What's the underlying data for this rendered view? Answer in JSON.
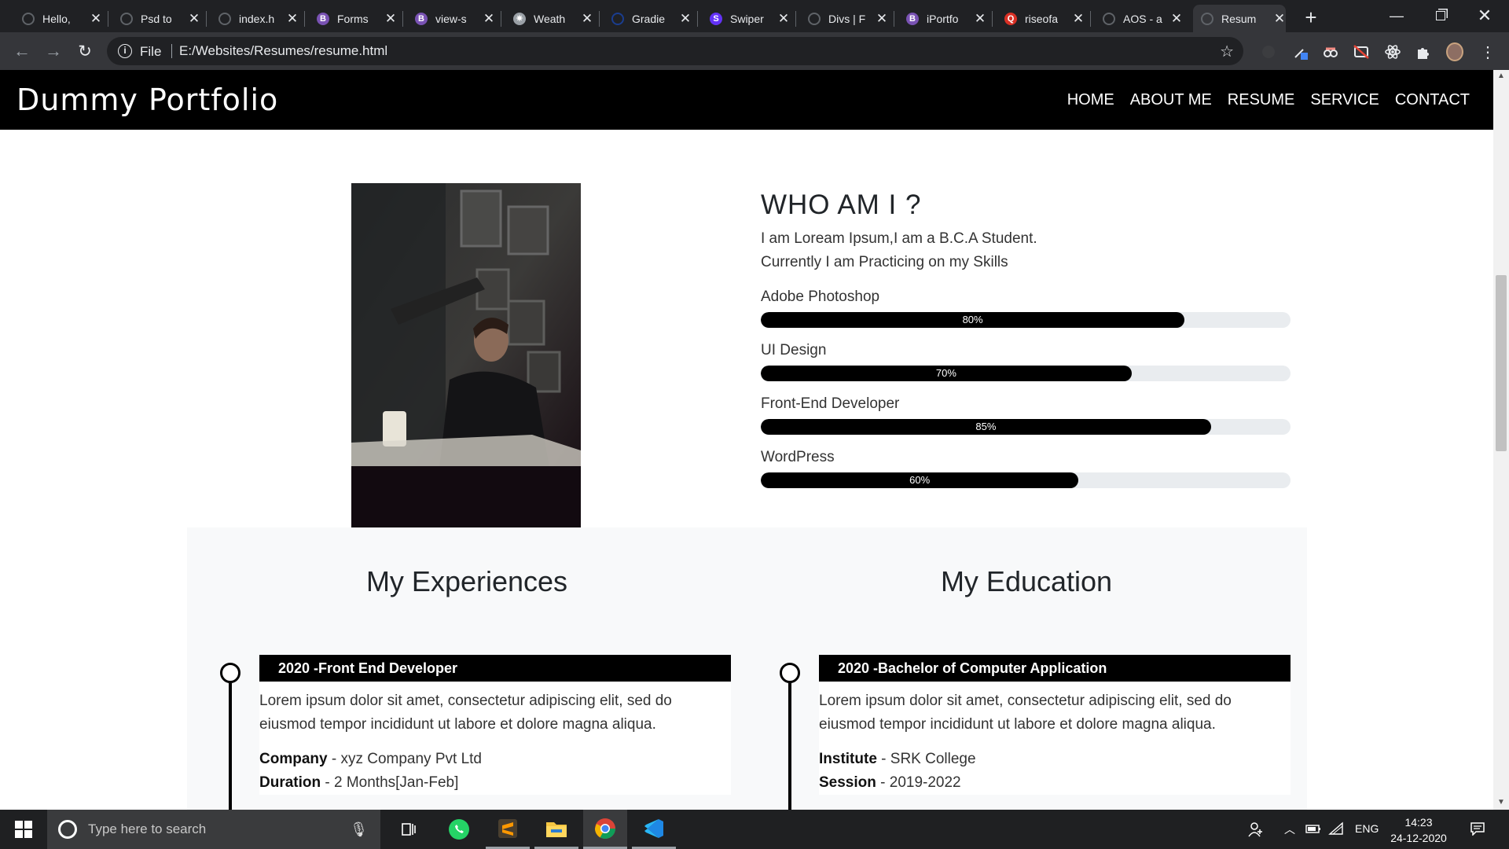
{
  "browser": {
    "tabs": [
      {
        "title": "Hello, ",
        "fav_color": "#5f6368",
        "fav_glyph": ""
      },
      {
        "title": "Psd to",
        "fav_color": "#5f6368",
        "fav_glyph": ""
      },
      {
        "title": "index.h",
        "fav_color": "#5f6368",
        "fav_glyph": ""
      },
      {
        "title": "Forms",
        "fav_color": "#7952b3",
        "fav_glyph": "B"
      },
      {
        "title": "view-s",
        "fav_color": "#7952b3",
        "fav_glyph": "B"
      },
      {
        "title": "Weath",
        "fav_color": "#9aa0a6",
        "fav_glyph": "✷"
      },
      {
        "title": "Gradie",
        "fav_color": "#1a3d8f",
        "fav_glyph": ""
      },
      {
        "title": "Swiper",
        "fav_color": "#6332f6",
        "fav_glyph": "S"
      },
      {
        "title": "Divs | F",
        "fav_color": "#5f6368",
        "fav_glyph": ""
      },
      {
        "title": "iPortfo",
        "fav_color": "#7952b3",
        "fav_glyph": "B"
      },
      {
        "title": "riseofa",
        "fav_color": "#d93025",
        "fav_glyph": "Q"
      },
      {
        "title": "AOS - a",
        "fav_color": "#5f6368",
        "fav_glyph": ""
      },
      {
        "title": "Resum",
        "fav_color": "#5f6368",
        "fav_glyph": ""
      }
    ],
    "url_scheme": "File",
    "url": "E:/Websites/Resumes/resume.html"
  },
  "site": {
    "brand": "Dummy Portfolio",
    "menu": [
      "HOME",
      "ABOUT ME",
      "RESUME",
      "SERVICE",
      "CONTACT"
    ]
  },
  "about": {
    "heading": "WHO AM I ?",
    "intro_line1": "I am Loream Ipsum,I am a B.C.A Student.",
    "intro_line2": "Currently I am Practicing on my Skills",
    "skills": [
      {
        "name": "Adobe Photoshop",
        "percent": 80,
        "label": "80%"
      },
      {
        "name": "UI Design",
        "percent": 70,
        "label": "70%"
      },
      {
        "name": "Front-End Developer",
        "percent": 85,
        "label": "85%"
      },
      {
        "name": "WordPress",
        "percent": 60,
        "label": "60%"
      }
    ]
  },
  "experience": {
    "heading": "My Experiences",
    "item": {
      "title": "2020 -Front End Developer",
      "body": "Lorem ipsum dolor sit amet, consectetur adipiscing elit, sed do eiusmod tempor incididunt ut labore et dolore magna aliqua.",
      "k1": "Company",
      "v1": " - xyz Company Pvt Ltd",
      "k2": "Duration",
      "v2": " - 2 Months[Jan-Feb]"
    }
  },
  "education": {
    "heading": "My Education",
    "item": {
      "title": "2020 -Bachelor of Computer Application",
      "body": "Lorem ipsum dolor sit amet, consectetur adipiscing elit, sed do eiusmod tempor incididunt ut labore et dolore magna aliqua.",
      "k1": "Institute",
      "v1": " - SRK College",
      "k2": "Session",
      "v2": " - 2019-2022"
    }
  },
  "taskbar": {
    "search_placeholder": "Type here to search",
    "lang": "ENG",
    "time": "14:23",
    "date": "24-12-2020"
  }
}
